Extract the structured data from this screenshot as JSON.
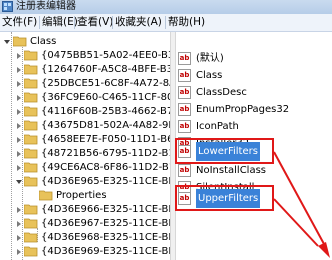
{
  "window": {
    "title": "注册表编辑器"
  },
  "menu": [
    "文件(F)",
    "编辑(E)",
    "查看(V)",
    "收藏夹(A)",
    "帮助(H)"
  ],
  "tree": {
    "root": "Class",
    "items": [
      "{0475BB51-5A02-4EE0-B36",
      "{1264760F-A5C8-4BFE-B31",
      "{25DBCE51-6C8F-4A72-8A",
      "{36FC9E60-C465-11CF-805",
      "{4116F60B-25B3-4662-B73",
      "{43675D81-502A-4A82-9F8",
      "{4658EE7E-F050-11D1-B6E",
      "{48721B56-6795-11D2-B1A",
      "{49CE6AC8-6F86-11D2-B1E",
      "{4D36E965-E325-11CE-BFC",
      "Properties",
      "{4D36E966-E325-11CE-BFC",
      "{4D36E967-E325-11CE-BFC",
      "{4D36E968-E325-11CE-BFC",
      "{4D36E969-E325-11CE-BFC"
    ]
  },
  "values": {
    "items": [
      "(默认)",
      "Class",
      "ClassDesc",
      "EnumPropPages32",
      "IconPath",
      "Installer32",
      "LowerFilters",
      "NoInstallClass",
      "SilentInstall",
      "UpperFilters"
    ],
    "icon_label": "ab"
  },
  "colors": {
    "folder": "#e8c25a",
    "selection": "#3a82d8",
    "highlight_box": "#e01818"
  }
}
